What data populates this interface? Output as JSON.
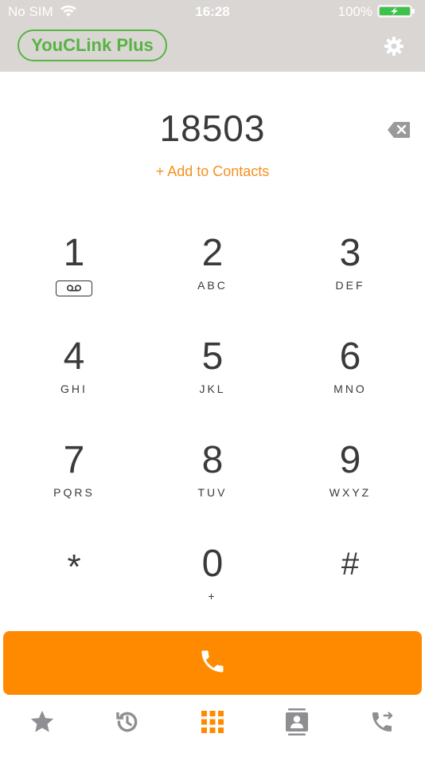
{
  "status_bar": {
    "carrier": "No SIM",
    "time": "16:28",
    "battery_percent": "100%"
  },
  "header": {
    "brand": "YouCLink Plus",
    "settings_icon": "gear-icon"
  },
  "dialer": {
    "number": "18503",
    "add_contacts": "+ Add to Contacts",
    "backspace_icon": "backspace-icon"
  },
  "keypad": [
    {
      "digit": "1",
      "letters": "",
      "voicemail": true
    },
    {
      "digit": "2",
      "letters": "ABC"
    },
    {
      "digit": "3",
      "letters": "DEF"
    },
    {
      "digit": "4",
      "letters": "GHI"
    },
    {
      "digit": "5",
      "letters": "JKL"
    },
    {
      "digit": "6",
      "letters": "MNO"
    },
    {
      "digit": "7",
      "letters": "PQRS"
    },
    {
      "digit": "8",
      "letters": "TUV"
    },
    {
      "digit": "9",
      "letters": "WXYZ"
    },
    {
      "digit": "*",
      "letters": ""
    },
    {
      "digit": "0",
      "letters": "+"
    },
    {
      "digit": "#",
      "letters": ""
    }
  ],
  "call_button_icon": "phone-icon",
  "tabs": [
    {
      "icon": "star-icon",
      "active": false
    },
    {
      "icon": "history-icon",
      "active": false
    },
    {
      "icon": "keypad-icon",
      "active": true
    },
    {
      "icon": "contacts-icon",
      "active": false
    },
    {
      "icon": "call-transfer-icon",
      "active": false
    }
  ],
  "colors": {
    "accent": "#ff8a00",
    "brand_green": "#58b343",
    "header_bg": "#d9d6d4",
    "tab_inactive": "#8e8e93"
  }
}
